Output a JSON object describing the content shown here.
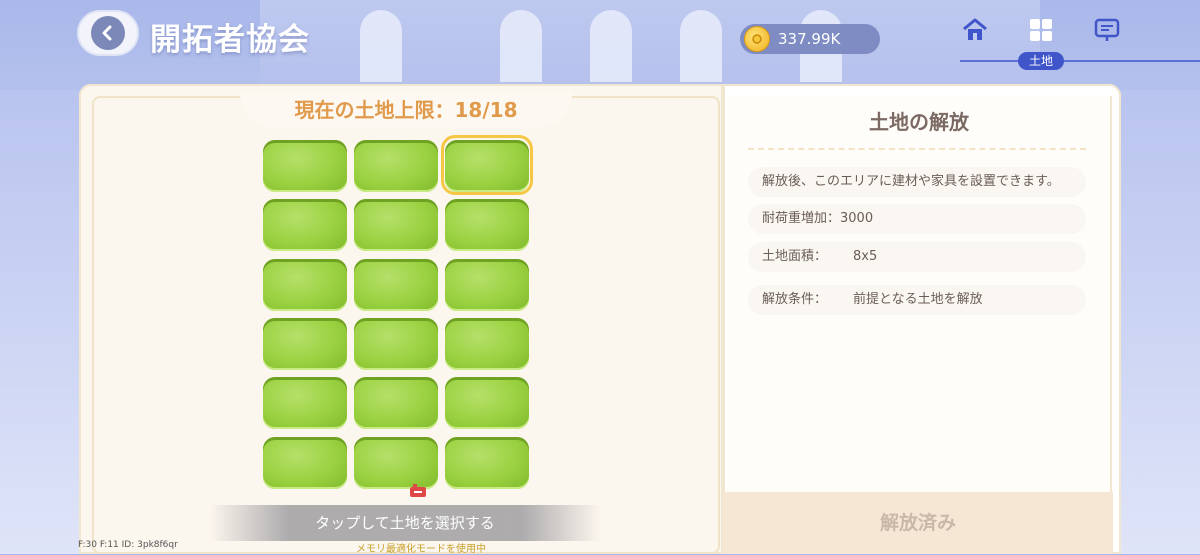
{
  "header": {
    "title": "開拓者協会",
    "currency": {
      "amount": "337.99K",
      "icon": "coin-icon"
    },
    "nav": {
      "active_badge": "土地"
    }
  },
  "left_panel": {
    "limit_label": "現在の土地上限：18/18",
    "grid": {
      "rows": 6,
      "cols": 3,
      "plot_count": 18,
      "selected_index": 2
    },
    "hint": "タップして土地を選択する",
    "debug": "F:30   F:11   ID: 3pk8f6qr",
    "memory_notice": "メモリ最適化モードを使用中"
  },
  "right_panel": {
    "title": "土地の解放",
    "rows": [
      {
        "text": "解放後、このエリアに建材や家具を設置できます。"
      },
      {
        "label": "耐荷重増加：",
        "value": "3000"
      },
      {
        "label": "土地面積：",
        "value": "8x5"
      },
      {
        "label": "解放条件：",
        "value": "前提となる土地を解放"
      }
    ],
    "button": "解放済み"
  },
  "colors": {
    "accent": "#e09a4c",
    "nav_active": "#3f55c9",
    "plot": "#9ad140",
    "selected_outline": "#f6c744"
  }
}
